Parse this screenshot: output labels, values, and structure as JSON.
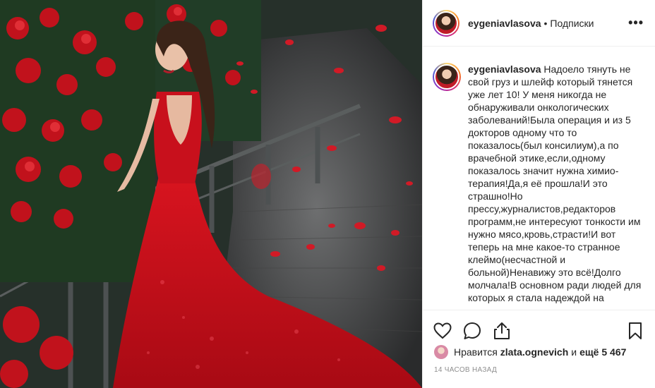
{
  "post": {
    "username": "eygeniavlasova",
    "separator": "•",
    "follow_label": "Подписки",
    "more_label": "•••",
    "caption": "Надоело тянуть не свой груз и шлейф который тянется уже лет 10! У меня никогда не обнаруживали онкологических заболеваний!Была операция и из 5 докторов одному что то показалось(был консилиум),а по врачебной этике,если,одному показалось значит нужна химио-терапия!Да,я её прошла!И это страшно!Но прессу,журналистов,редакторов программ,не интересуют тонкости им нужно мясо,кровь,страсти!И вот теперь на мне какое-то странное клеймо(несчастной и больной)Ненавижу это всё!Долго молчала!В основном ради людей для которых я стала надеждой на",
    "likes_prefix": "Нравится",
    "likes_user": "zlata.ognevich",
    "likes_middle": "и",
    "likes_suffix": "ещё 5 467",
    "timestamp": "14 часов назад"
  },
  "icons": {
    "like": "heart-outline-icon",
    "comment": "comment-bubble-icon",
    "share": "share-upload-icon",
    "save": "bookmark-icon",
    "more": "ellipsis-icon"
  },
  "colors": {
    "text": "#262626",
    "muted": "#8e8e8e",
    "border": "#efefef",
    "dress": "#c8101c"
  }
}
